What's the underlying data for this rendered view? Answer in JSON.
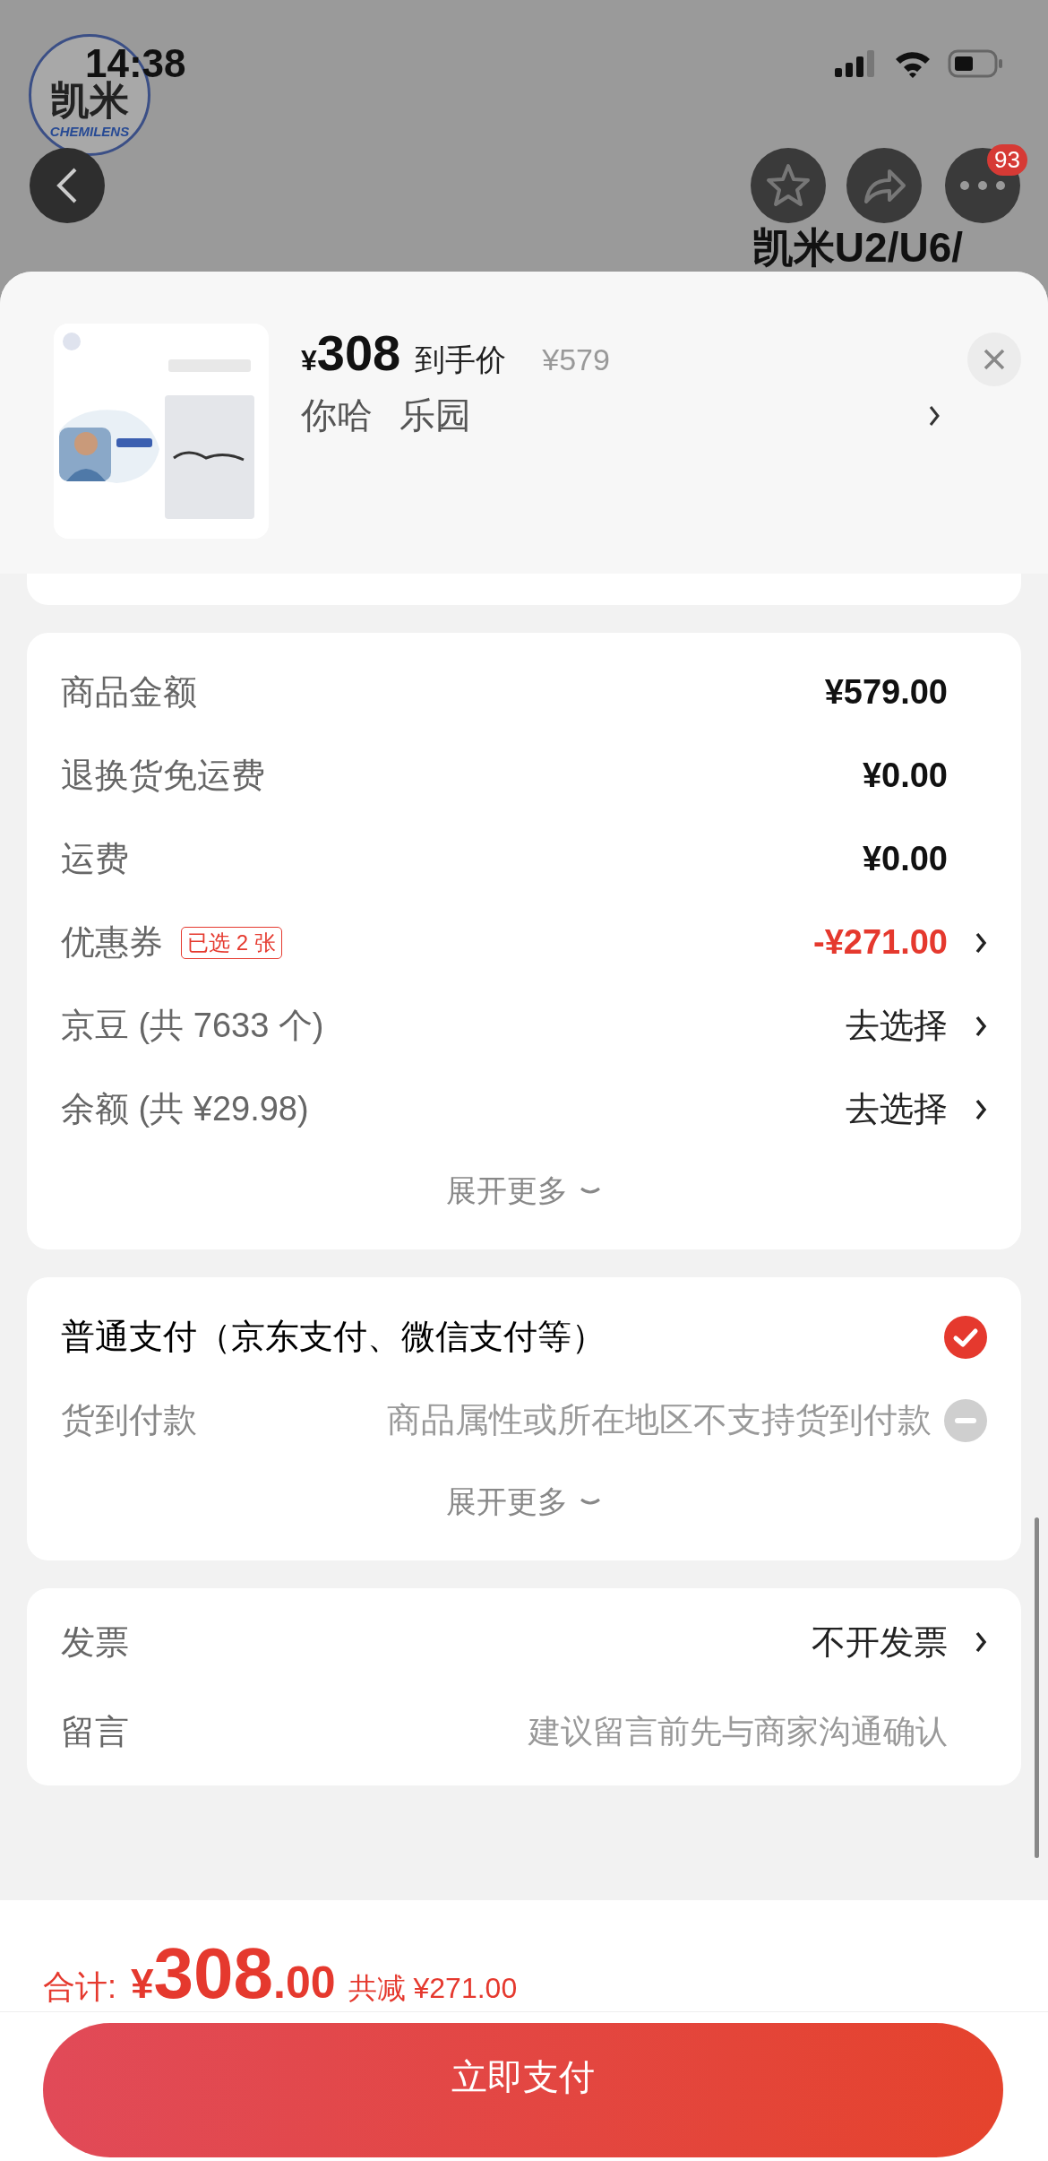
{
  "status_bar": {
    "time": "14:38"
  },
  "backdrop": {
    "logo": {
      "mark": "凯米",
      "name": "CHEMILENS"
    },
    "title_lines": [
      "凯米U2/U6/"
    ],
    "badge": "93"
  },
  "product": {
    "currency": "¥",
    "price": "308",
    "price_label": "到手价",
    "original_price": "¥579",
    "spec": [
      "你哈",
      "乐园"
    ]
  },
  "summary": {
    "rows": [
      {
        "label": "商品金额",
        "value": "¥579.00",
        "kind": "amount"
      },
      {
        "label": "退换货免运费",
        "value": "¥0.00",
        "kind": "amount"
      },
      {
        "label": "运费",
        "value": "¥0.00",
        "kind": "amount"
      },
      {
        "label": "优惠券",
        "tag": "已选 2 张",
        "value": "-¥271.00",
        "kind": "discount"
      },
      {
        "label": "京豆 (共 7633 个)",
        "value": "去选择",
        "kind": "action"
      },
      {
        "label": "余额 (共 ¥29.98)",
        "value": "去选择",
        "kind": "action"
      }
    ],
    "expand": "展开更多"
  },
  "payment": {
    "options": [
      {
        "label": "普通支付（京东支付、微信支付等）",
        "selected": true,
        "disabled": false
      },
      {
        "label": "货到付款",
        "note": "商品属性或所在地区不支持货到付款",
        "selected": false,
        "disabled": true
      }
    ],
    "expand": "展开更多"
  },
  "extras": {
    "rows": [
      {
        "label": "发票",
        "value": "不开发票",
        "kind": "action"
      },
      {
        "label": "留言",
        "placeholder": "建议留言前先与商家沟通确认",
        "kind": "input"
      }
    ]
  },
  "footer": {
    "total_label": "合计:",
    "currency": "¥",
    "total_int": "308",
    "total_dec": ".00",
    "saved": "共减 ¥271.00",
    "pay_button": "立即支付"
  }
}
